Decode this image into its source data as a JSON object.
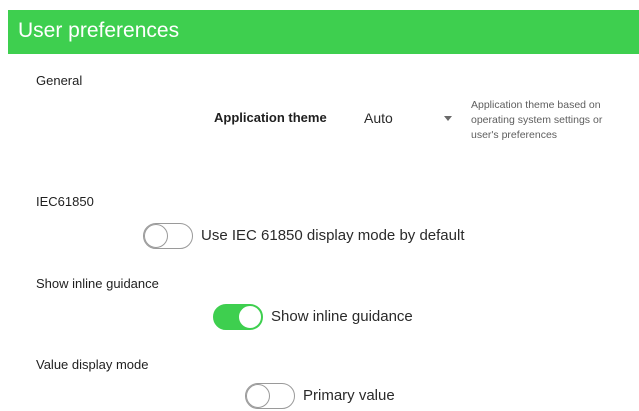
{
  "header": {
    "title": "User preferences"
  },
  "general": {
    "section_label": "General",
    "theme": {
      "label": "Application theme",
      "value": "Auto",
      "help": "Application theme based on operating system settings or user's preferences"
    }
  },
  "iec61850": {
    "section_label": "IEC61850",
    "toggle": {
      "label": "Use IEC 61850 display mode by default",
      "checked": false
    }
  },
  "inline_guidance": {
    "section_label": "Show inline guidance",
    "toggle": {
      "label": "Show inline guidance",
      "checked": true
    }
  },
  "value_display_mode": {
    "section_label": "Value display mode",
    "toggle": {
      "label": "Primary value",
      "checked": false
    }
  },
  "colors": {
    "accent": "#3ecf4f",
    "toggle_off_border": "#9a9a9a"
  },
  "icons": {
    "dropdown": "chevron-down-icon"
  }
}
